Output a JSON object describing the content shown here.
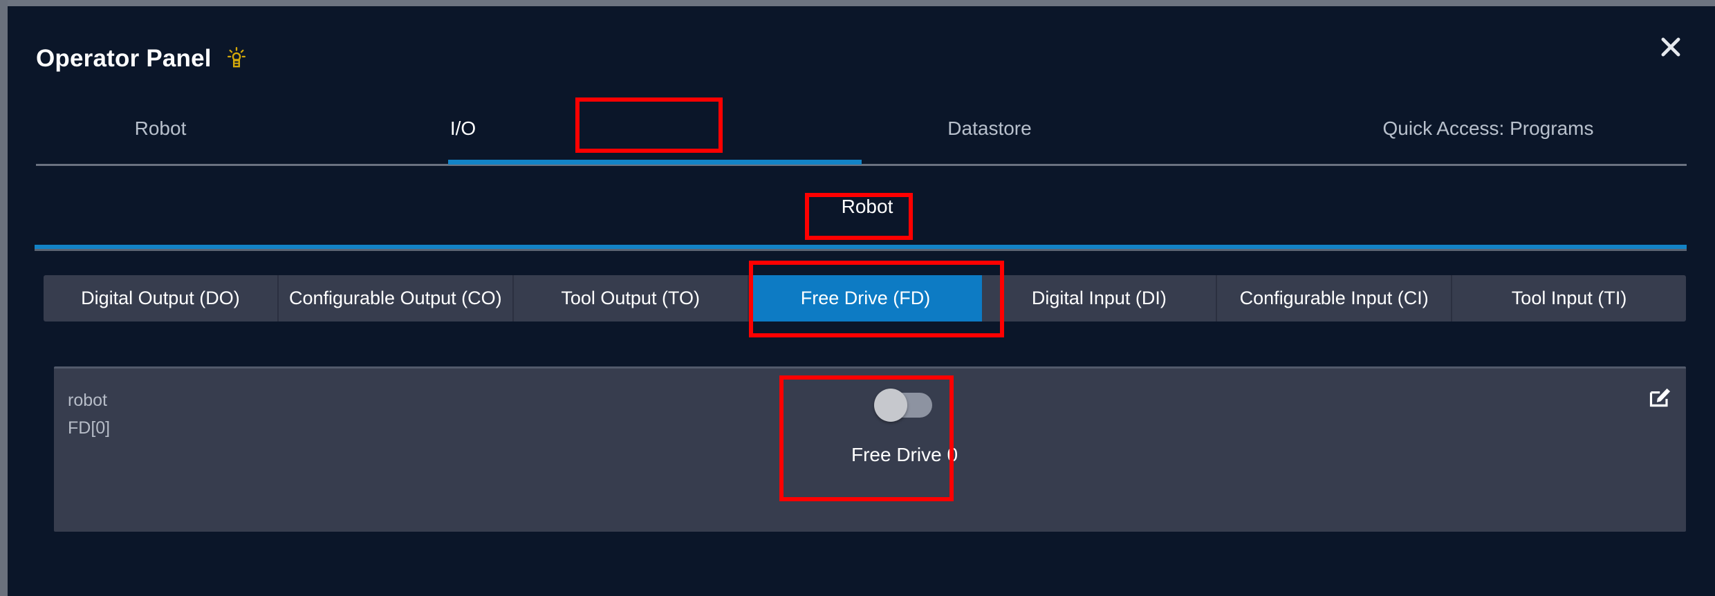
{
  "window": {
    "title": "Operator Panel",
    "bulb_icon": "lightbulb-icon",
    "bulb_color": "#d4a90a",
    "close_icon": "close-icon"
  },
  "tabs": [
    {
      "label": "Robot",
      "active": false
    },
    {
      "label": "I/O",
      "active": true
    },
    {
      "label": "Datastore",
      "active": false
    },
    {
      "label": "Quick Access: Programs",
      "active": false
    }
  ],
  "subtabs": [
    {
      "label": "Robot",
      "active": true
    }
  ],
  "io_types": [
    {
      "label": "Digital Output (DO)",
      "active": false
    },
    {
      "label": "Configurable Output (CO)",
      "active": false
    },
    {
      "label": "Tool Output (TO)",
      "active": false
    },
    {
      "label": "Free Drive (FD)",
      "active": true
    },
    {
      "label": "Digital Input (DI)",
      "active": false
    },
    {
      "label": "Configurable Input (CI)",
      "active": false
    },
    {
      "label": "Tool Input (TI)",
      "active": false
    }
  ],
  "card": {
    "source": "robot",
    "address": "FD[0]",
    "toggle_label": "Free Drive 0",
    "toggle_state": "off",
    "edit_icon": "edit-icon"
  },
  "colors": {
    "accent_blue": "#1383c6",
    "active_button_blue": "#0d7bc4",
    "panel_bg": "#0b1629",
    "card_bg": "#373d4e",
    "annotation_red": "#ff0000"
  }
}
